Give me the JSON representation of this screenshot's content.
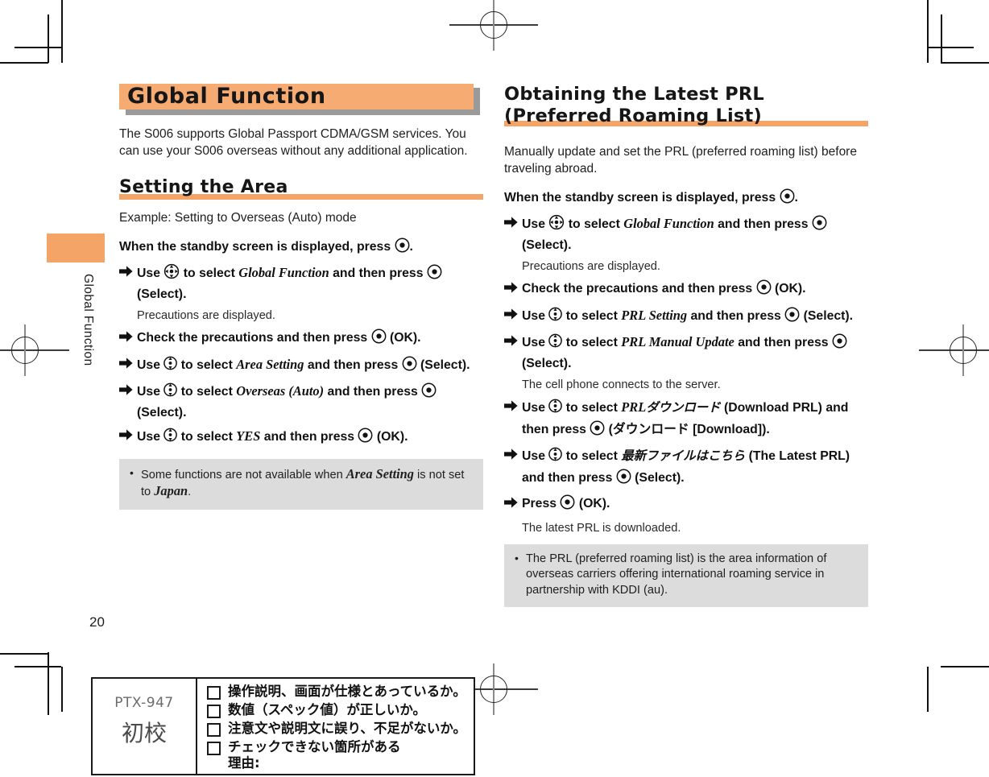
{
  "page": {
    "number": "20",
    "side_tab_label": "Global Function"
  },
  "left_column": {
    "banner_title": "Global Function",
    "intro": "The S006 supports Global Passport CDMA/GSM services. You can use your S006 overseas without any additional application.",
    "section_title": "Setting the Area",
    "example_line": "Example: Setting to Overseas (Auto) mode",
    "step_lead": "When the standby screen is displayed, press",
    "step_lead_tail": ".",
    "steps": [
      {
        "icon": "center-key-icon",
        "pre": "Use",
        "nav_icon": "four-way-key-icon",
        "mid": "to select",
        "italic": "Global Function",
        "post": "and then press",
        "key_icon": "center-key-icon",
        "tail": "(Select).",
        "sub": "Precautions are displayed."
      },
      {
        "pre": "Check the precautions and then press",
        "key_icon": "center-key-icon",
        "tail": "(OK).",
        "sub": ""
      },
      {
        "pre": "Use",
        "nav_icon": "updown-key-icon",
        "mid": "to select",
        "italic": "Area Setting",
        "post": "and then press",
        "key_icon": "center-key-icon",
        "tail": "(Select).",
        "sub": ""
      },
      {
        "pre": "Use",
        "nav_icon": "updown-key-icon",
        "mid": "to select",
        "italic": "Overseas (Auto)",
        "post": "and then press",
        "key_icon": "center-key-icon",
        "tail": "(Select).",
        "sub": ""
      },
      {
        "pre": "Use",
        "nav_icon": "updown-key-icon",
        "mid": "to select",
        "italic": "YES",
        "post": "and then press",
        "key_icon": "center-key-icon",
        "tail": "(OK).",
        "sub": ""
      }
    ],
    "note": {
      "text_a": "Some functions are not available when ",
      "italic_a": "Area Setting",
      "text_b": " is not set to ",
      "italic_b": "Japan",
      "text_c": "."
    }
  },
  "right_column": {
    "heading_line1": "Obtaining the Latest PRL",
    "heading_line2": "(Preferred Roaming List)",
    "lead": "Manually update and set the PRL (preferred roaming list) before traveling abroad.",
    "step_lead": "When the standby screen is displayed, press",
    "step_lead_tail": ".",
    "steps": [
      {
        "pre": "Use",
        "nav_icon": "four-way-key-icon",
        "mid": "to select",
        "italic": "Global Function",
        "post": "and then press",
        "key_icon": "center-key-icon",
        "tail": "(Select).",
        "sub": "Precautions are displayed."
      },
      {
        "pre": "Check the precautions and then press",
        "key_icon": "center-key-icon",
        "tail": "(OK).",
        "sub": ""
      },
      {
        "pre": "Use",
        "nav_icon": "updown-key-icon",
        "mid": "to select",
        "italic": "PRL Setting",
        "post": "and then press",
        "key_icon": "center-key-icon",
        "tail": "(Select).",
        "sub": ""
      },
      {
        "pre": "Use",
        "nav_icon": "updown-key-icon",
        "mid": "to select",
        "italic": "PRL Manual Update",
        "post": "and then press",
        "key_icon": "center-key-icon",
        "tail": "(Select).",
        "sub": "The cell phone connects to the server."
      },
      {
        "pre": "Use",
        "nav_icon": "updown-key-icon",
        "mid": "to select",
        "italic": "PRL",
        "italic_jp": "ダウンロード",
        "post": "(Download PRL) and then press",
        "key_icon": "center-key-icon",
        "tail": "(ダウンロード [Download]).",
        "sub": ""
      },
      {
        "pre": "Use",
        "nav_icon": "updown-key-icon",
        "mid": "to select",
        "italic_jp": "最新ファイルはこちら",
        "post": "(The Latest PRL) and then press",
        "key_icon": "center-key-icon",
        "tail": "(Select).",
        "sub": ""
      },
      {
        "pre": "Press",
        "key_icon": "center-key-icon",
        "tail": "(OK).",
        "sub": "The latest PRL is downloaded."
      }
    ],
    "note": {
      "text": "The PRL (preferred roaming list) is the area information of overseas carriers offering international roaming service in partnership with KDDI (au)."
    }
  },
  "proof_stamp": {
    "code": "PTX-947",
    "stage": "初校",
    "checklist": [
      "操作説明、画面が仕様とあっているか。",
      "数値（スペック値）が正しいか。",
      "注意文や説明文に誤り、不足がないか。",
      "チェックできない箇所がある"
    ],
    "reason_label": "理由:"
  },
  "colors": {
    "accent_orange": "#F5A468",
    "banner_orange": "#F5AB72",
    "note_gray": "#DCDCDC",
    "text": "#1a1a1a"
  }
}
